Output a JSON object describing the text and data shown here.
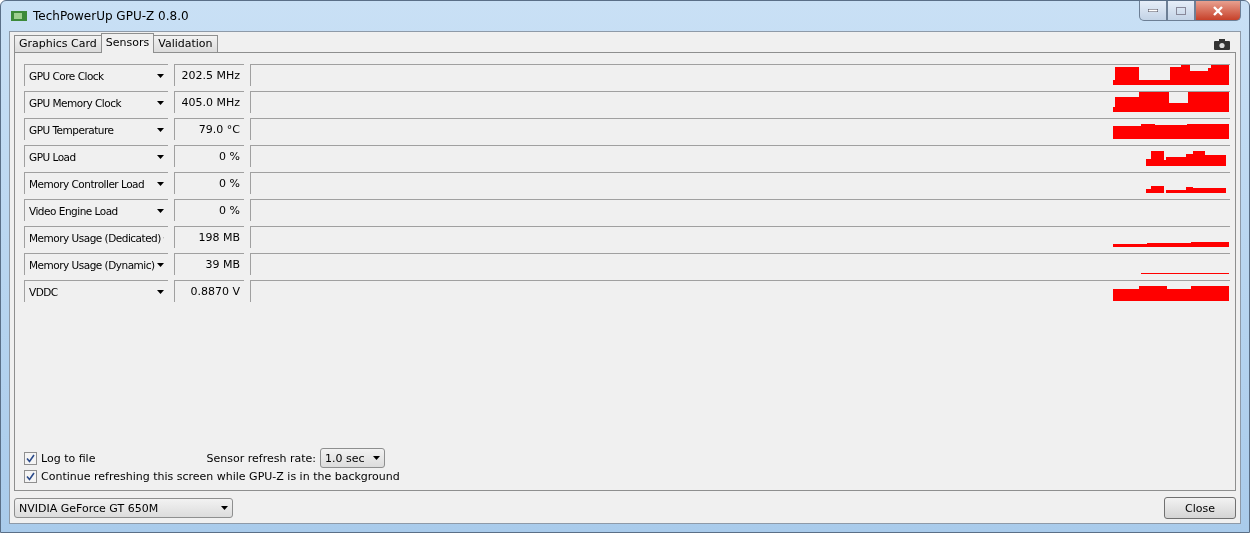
{
  "window": {
    "title": "TechPowerUp GPU-Z 0.8.0"
  },
  "tabs": [
    {
      "label": "Graphics Card",
      "selected": false
    },
    {
      "label": "Sensors",
      "selected": true
    },
    {
      "label": "Validation",
      "selected": false
    }
  ],
  "sensors": [
    {
      "name": "GPU Core Clock",
      "value": "202.5 MHz"
    },
    {
      "name": "GPU Memory Clock",
      "value": "405.0 MHz"
    },
    {
      "name": "GPU Temperature",
      "value": "79.0 °C"
    },
    {
      "name": "GPU Load",
      "value": "0 %"
    },
    {
      "name": "Memory Controller Load",
      "value": "0 %"
    },
    {
      "name": "Video Engine Load",
      "value": "0 %"
    },
    {
      "name": "Memory Usage (Dedicated)",
      "value": "198 MB"
    },
    {
      "name": "Memory Usage (Dynamic)",
      "value": "39 MB"
    },
    {
      "name": "VDDC",
      "value": "0.8870 V"
    }
  ],
  "log_to_file": {
    "label": "Log to file",
    "checked": true
  },
  "refresh_rate": {
    "label": "Sensor refresh rate:",
    "value": "1.0 sec"
  },
  "background_refresh": {
    "label": "Continue refreshing this screen while GPU-Z is in the background",
    "checked": true
  },
  "gpu_select": {
    "value": "NVIDIA GeForce GT 650M"
  },
  "buttons": [
    "Close"
  ]
}
